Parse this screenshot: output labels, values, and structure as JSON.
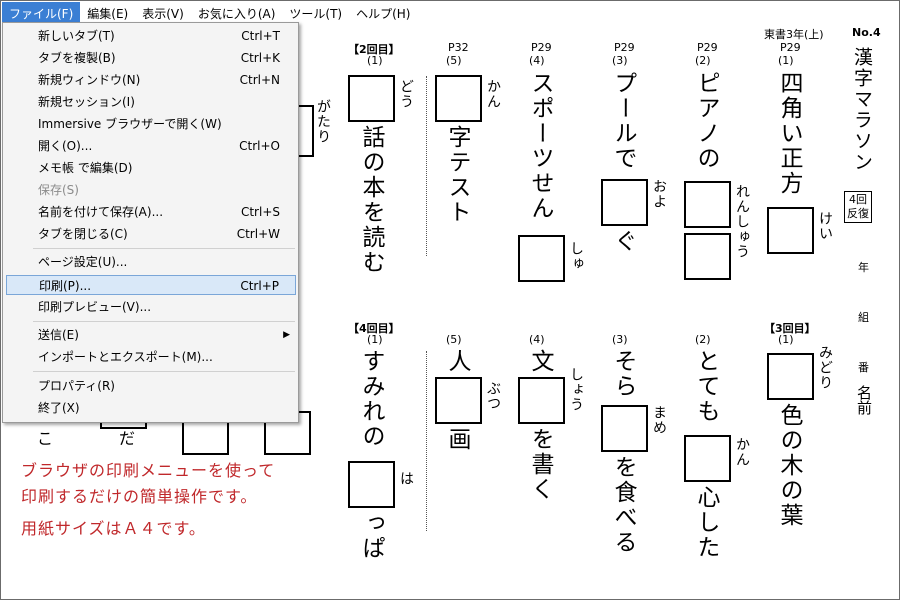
{
  "menubar": {
    "items": [
      "ファイル(F)",
      "編集(E)",
      "表示(V)",
      "お気に入り(A)",
      "ツール(T)",
      "ヘルプ(H)"
    ]
  },
  "file_menu": {
    "items": [
      {
        "label": "新しいタブ(T)",
        "shortcut": "Ctrl+T"
      },
      {
        "label": "タブを複製(B)",
        "shortcut": "Ctrl+K"
      },
      {
        "label": "新規ウィンドウ(N)",
        "shortcut": "Ctrl+N"
      },
      {
        "label": "新規セッション(I)",
        "shortcut": ""
      },
      {
        "label": "Immersive ブラウザーで開く(W)",
        "shortcut": ""
      },
      {
        "label": "開く(O)...",
        "shortcut": "Ctrl+O"
      },
      {
        "label": "メモ帳 で編集(D)",
        "shortcut": ""
      },
      {
        "label": "保存(S)",
        "shortcut": "",
        "disabled": true
      },
      {
        "label": "名前を付けて保存(A)...",
        "shortcut": "Ctrl+S"
      },
      {
        "label": "タブを閉じる(C)",
        "shortcut": "Ctrl+W"
      },
      {
        "label": "ページ設定(U)...",
        "shortcut": ""
      },
      {
        "label": "印刷(P)...",
        "shortcut": "Ctrl+P",
        "highlighted": true
      },
      {
        "label": "印刷プレビュー(V)...",
        "shortcut": ""
      },
      {
        "label": "送信(E)",
        "shortcut": "",
        "submenu": true
      },
      {
        "label": "インポートとエクスポート(M)...",
        "shortcut": ""
      },
      {
        "label": "プロパティ(R)",
        "shortcut": ""
      },
      {
        "label": "終了(X)",
        "shortcut": ""
      }
    ]
  },
  "worksheet": {
    "publisher": "東書3年(上)",
    "number": "No.4",
    "title": "漢字マラソン",
    "badge": [
      "4回",
      "反復"
    ],
    "name_fields": [
      "年",
      "組",
      "番",
      "名前"
    ],
    "round2_label": "【2回目】",
    "round3_label": "【3回目】",
    "round4_label": "【4回目】",
    "top_row": [
      {
        "page": "P29",
        "num": "(1)",
        "text_before": "四角い正方",
        "furigana": "けい",
        "text_after": ""
      },
      {
        "page": "P29",
        "num": "(2)",
        "text_before": "ピアノの",
        "furigana": "れんしゅう",
        "text_after": ""
      },
      {
        "page": "P29",
        "num": "(3)",
        "text_before": "プールで",
        "furigana": "およ",
        "text_after": "ぐ"
      },
      {
        "page": "P29",
        "num": "(4)",
        "text_before": "スポーツせん",
        "furigana": "しゅ",
        "text_after": ""
      },
      {
        "page": "P32",
        "num": "(5)",
        "text_before": "",
        "furigana": "かん",
        "text_after": "字テスト"
      },
      {
        "page": "",
        "num": "(1)",
        "text_before": "",
        "furigana": "どう",
        "text_after": "話の本を読む"
      },
      {
        "page": "",
        "num": "",
        "text_before": "",
        "furigana": "がたり",
        "text_after": ""
      }
    ],
    "bottom_row": [
      {
        "num": "(1)",
        "text_before": "",
        "furigana": "みどり",
        "text_after": "色の木の葉"
      },
      {
        "num": "(2)",
        "text_before": "とても",
        "furigana": "かん",
        "text_after": "心した"
      },
      {
        "num": "(3)",
        "text_before": "そら",
        "furigana": "まめ",
        "text_after": "を食べる"
      },
      {
        "num": "(4)",
        "text_before": "文",
        "furigana": "しょう",
        "text_after": "を書く"
      },
      {
        "num": "(5)",
        "text_before": "人",
        "furigana": "ぶつ",
        "text_after": "画"
      },
      {
        "num": "(1)",
        "text_before": "すみれの",
        "furigana": "は",
        "text_after": "っぱ"
      }
    ],
    "partial_left_text": [
      "こ",
      "だ"
    ]
  },
  "caption": {
    "line1": "ブラウザの印刷メニューを使って",
    "line2": "印刷するだけの簡単操作です。",
    "line3": "用紙サイズはＡ４です。",
    "color": "#c0282b"
  }
}
